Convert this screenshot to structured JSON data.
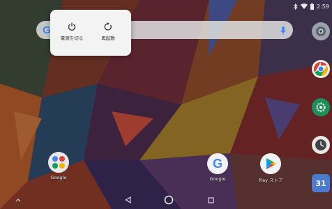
{
  "status_bar": {
    "time": "2:59",
    "icons": [
      "bluetooth-icon",
      "wifi-icon",
      "battery-icon"
    ]
  },
  "search_bar": {
    "logo": "G",
    "icons": [
      "google-logo-icon",
      "mic-icon"
    ]
  },
  "power_menu": {
    "items": [
      {
        "label": "電源を切る",
        "icon": "power-icon"
      },
      {
        "label": "再起動",
        "icon": "restart-icon"
      }
    ]
  },
  "side_dock": {
    "icons": [
      "camera-icon",
      "chrome-icon",
      "settings-icon",
      "clock-icon",
      "calendar-icon"
    ],
    "calendar_day": "31"
  },
  "home_apps": [
    {
      "label": "Google",
      "icon": "google-folder-icon"
    },
    {
      "label": "Google",
      "icon": "google-app-icon"
    },
    {
      "label": "Play ストア",
      "icon": "play-store-icon"
    }
  ],
  "nav_bar": {
    "icons": [
      "back-icon",
      "home-icon",
      "recents-icon",
      "app-drawer-chevron-icon"
    ]
  },
  "colors": {
    "menu_bg": "#f3f3f3",
    "search_bg": "#e1e1e1",
    "google_blue": "#4285f4",
    "settings_green": "#1e8e5a"
  }
}
